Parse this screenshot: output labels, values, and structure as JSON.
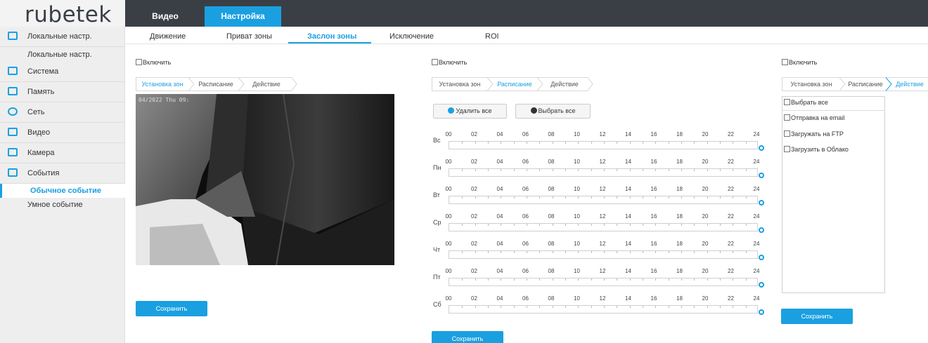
{
  "logo": {
    "text": "rubetek"
  },
  "top_tabs": [
    {
      "label": "Видео"
    },
    {
      "label": "Настройка"
    }
  ],
  "sidebar": {
    "items": [
      {
        "label": "Локальные настр.",
        "icon": "monitor-icon"
      },
      {
        "label": "Система",
        "icon": "system-icon"
      },
      {
        "label": "Память",
        "icon": "disk-icon"
      },
      {
        "label": "Сеть",
        "icon": "network-icon"
      },
      {
        "label": "Видео",
        "icon": "video-icon"
      },
      {
        "label": "Камера",
        "icon": "image-icon"
      },
      {
        "label": "События",
        "icon": "events-icon"
      }
    ],
    "sub_local": "Локальные настр.",
    "sub_events": [
      "Обычное событие",
      "Умное событие"
    ]
  },
  "sub_tabs": [
    "Движение",
    "Приват зоны",
    "Заслон зоны",
    "Исключение",
    "ROI"
  ],
  "accent_color": "#1aa0e0",
  "panels": {
    "enable_label": "Включить",
    "steps": [
      "Установка зон",
      "Расписание",
      "Действие"
    ],
    "save_label": "Сохранить"
  },
  "camera": {
    "timestamp": "04/2022 Thu 09:"
  },
  "schedule": {
    "delete_all": "Удалить все",
    "select_all": "Выбрать все",
    "days": [
      "Вс",
      "Пн",
      "Вт",
      "Ср",
      "Чт",
      "Пт",
      "Сб"
    ],
    "hours": [
      "00",
      "02",
      "04",
      "06",
      "08",
      "10",
      "12",
      "14",
      "16",
      "18",
      "20",
      "22",
      "24"
    ]
  },
  "actions": {
    "items": [
      "Выбрать все",
      "Отправка на email",
      "Загружать на FTP",
      "Загрузить в Облако"
    ]
  }
}
